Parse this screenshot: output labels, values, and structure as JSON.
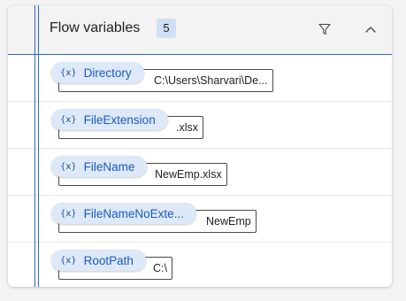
{
  "panel": {
    "title": "Flow variables",
    "count": "5",
    "filter_icon": "filter-icon",
    "collapse_icon": "chevron-up-icon",
    "accent_color": "#2f67c6"
  },
  "variables": [
    {
      "icon_text": "{x}",
      "name": "Directory",
      "value": "C:\\Users\\Sharvari\\De..."
    },
    {
      "icon_text": "{x}",
      "name": "FileExtension",
      "value": ".xlsx"
    },
    {
      "icon_text": "{x}",
      "name": "FileName",
      "value": "NewEmp.xlsx"
    },
    {
      "icon_text": "{x}",
      "name": "FileNameNoExte...",
      "value": "NewEmp"
    },
    {
      "icon_text": "{x}",
      "name": "RootPath",
      "value": "C:\\"
    }
  ]
}
